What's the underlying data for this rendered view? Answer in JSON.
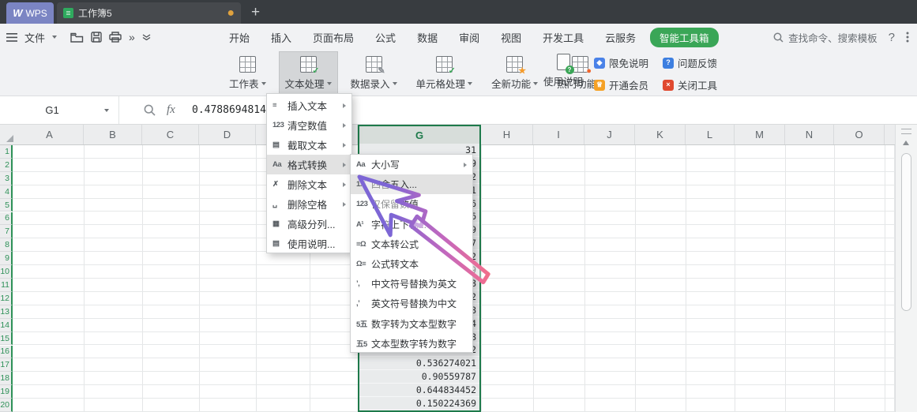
{
  "titlebar": {
    "wps_label": "WPS",
    "wps_logo": "W",
    "doc_tab": "工作簿5",
    "modified_dot": "●",
    "new_tab": "+"
  },
  "quickbar": {
    "file_label": "文件",
    "more_chevrons": "»",
    "menu_tabs": [
      "开始",
      "插入",
      "页面布局",
      "公式",
      "数据",
      "审阅",
      "视图",
      "开发工具",
      "云服务"
    ],
    "smart_toolbox": "智能工具箱",
    "search_label": "查找命令、搜索模板",
    "help_label": "?"
  },
  "toolbar": {
    "buttons": [
      {
        "label": "工作表",
        "icon": "worksheet-icon",
        "badge": "",
        "badge_color": ""
      },
      {
        "label": "文本处理",
        "icon": "text-process-icon",
        "badge": "✓",
        "badge_color": "#3aa657",
        "pressed": true
      },
      {
        "label": "数据录入",
        "icon": "data-entry-icon",
        "badge": "✎",
        "badge_color": "#8a8f94"
      },
      {
        "label": "单元格处理",
        "icon": "cell-process-icon",
        "badge": "✓",
        "badge_color": "#3aa657"
      },
      {
        "label": "全新功能",
        "icon": "new-features-icon",
        "badge": "★",
        "badge_color": "#f59b2c"
      },
      {
        "label": "热门功能",
        "icon": "hot-features-icon",
        "badge": "●",
        "badge_color": "#f0662d"
      }
    ],
    "usage_label": "使用说明",
    "usage_badge": "?",
    "links": [
      {
        "label": "限免说明",
        "icon": "tag-icon",
        "bg": "#4a82e8",
        "glyph": "◆"
      },
      {
        "label": "问题反馈",
        "icon": "question-circle-icon",
        "bg": "#3d7fe0",
        "glyph": "?"
      },
      {
        "label": "开通会员",
        "icon": "crown-icon",
        "bg": "#f5a125",
        "glyph": "♕"
      },
      {
        "label": "关闭工具",
        "icon": "close-tool-icon",
        "bg": "#e0492f",
        "glyph": "×"
      }
    ]
  },
  "formula_bar": {
    "name_box": "G1",
    "fx_label": "fx",
    "value": "0.47886948145"
  },
  "menu": {
    "items": [
      {
        "label": "插入文本",
        "icon": "insert-text-icon",
        "glyph": "≡",
        "arrow": true
      },
      {
        "label": "清空数值",
        "icon": "clear-values-icon",
        "glyph": "123",
        "arrow": true
      },
      {
        "label": "截取文本",
        "icon": "extract-text-icon",
        "glyph": "▤",
        "arrow": true
      },
      {
        "label": "格式转换",
        "icon": "format-convert-icon",
        "glyph": "Aa",
        "arrow": true,
        "highlight": true
      },
      {
        "label": "删除文本",
        "icon": "delete-text-icon",
        "glyph": "✗",
        "arrow": true
      },
      {
        "label": "删除空格",
        "icon": "delete-spaces-icon",
        "glyph": "␣",
        "arrow": true
      },
      {
        "label": "高级分列...",
        "icon": "advanced-split-icon",
        "glyph": "▦"
      },
      {
        "label": "使用说明...",
        "icon": "usage-help-icon",
        "glyph": "▤"
      }
    ]
  },
  "submenu": {
    "items": [
      {
        "label": "大小写",
        "icon": "letter-case-icon",
        "glyph": "Aa",
        "arrow": true
      },
      {
        "label": "四舍五入...",
        "icon": "rounding-icon",
        "glyph": "1.5",
        "highlight": true
      },
      {
        "label": "仅保留数值",
        "icon": "keep-numbers-icon",
        "glyph": "123"
      },
      {
        "label": "字符上下标...",
        "icon": "superscript-icon",
        "glyph": "A¹"
      },
      {
        "label": "文本转公式",
        "icon": "text-to-formula-icon",
        "glyph": "≡Ω"
      },
      {
        "label": "公式转文本",
        "icon": "formula-to-text-icon",
        "glyph": "Ω≡"
      },
      {
        "label": "中文符号替换为英文",
        "icon": "cn-to-en-symbol-icon",
        "glyph": "’,"
      },
      {
        "label": "英文符号替换为中文",
        "icon": "en-to-cn-symbol-icon",
        "glyph": ",’"
      },
      {
        "label": "数字转为文本型数字",
        "icon": "number-to-text-icon",
        "glyph": "5五"
      },
      {
        "label": "文本型数字转为数字",
        "icon": "text-to-number-icon",
        "glyph": "五5"
      }
    ]
  },
  "sheet": {
    "columns": [
      "A",
      "B",
      "C",
      "D",
      "E",
      "F",
      "G",
      "H",
      "I",
      "J",
      "K",
      "L",
      "M",
      "N",
      "O"
    ],
    "selected_column": "G",
    "rows": [
      {
        "n": "1",
        "g": "31"
      },
      {
        "n": "2",
        "g": "09"
      },
      {
        "n": "3",
        "g": "62"
      },
      {
        "n": "4",
        "g": "41"
      },
      {
        "n": "5",
        "g": "36"
      },
      {
        "n": "6",
        "g": "6"
      },
      {
        "n": "7",
        "g": "39"
      },
      {
        "n": "8",
        "g": "7"
      },
      {
        "n": "9",
        "g": "92"
      },
      {
        "n": "10",
        "g": "59"
      },
      {
        "n": "11",
        "g": "88"
      },
      {
        "n": "12",
        "g": "92"
      },
      {
        "n": "13",
        "g": "08"
      },
      {
        "n": "14",
        "g": "54"
      },
      {
        "n": "15",
        "g": "48"
      },
      {
        "n": "16",
        "g": "0.596994092"
      },
      {
        "n": "17",
        "g": "0.536274021"
      },
      {
        "n": "18",
        "g": "0.90559787"
      },
      {
        "n": "19",
        "g": "0.644834452"
      },
      {
        "n": "20",
        "g": "0.150224369"
      }
    ]
  },
  "colors": {
    "accent_green": "#3aa657",
    "selection_green": "#1e7a4b",
    "wps_blue": "#7b85c3",
    "unsaved_orange": "#e0a23e",
    "member_gold": "#f5a125",
    "close_red": "#e0492f",
    "tag_blue": "#4a82e8"
  }
}
